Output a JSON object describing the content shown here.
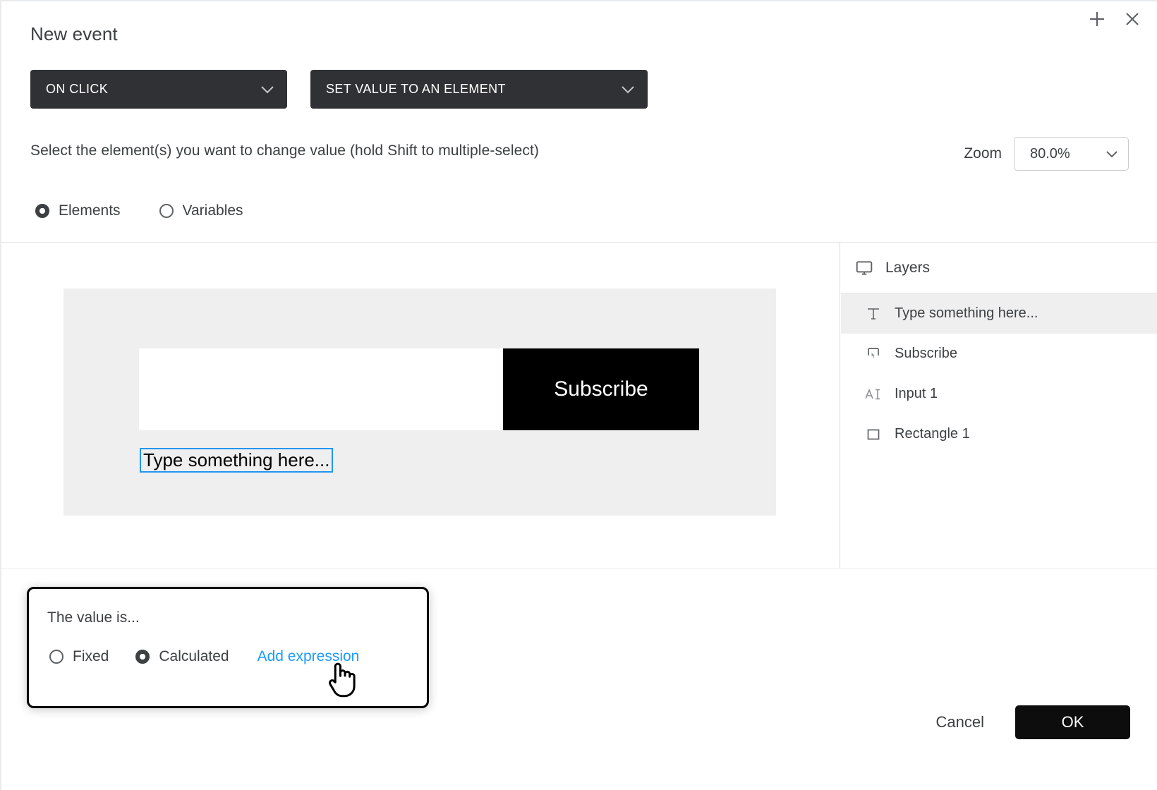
{
  "dialog": {
    "title": "New event",
    "add_icon": "plus-icon",
    "close_icon": "close-icon"
  },
  "event": {
    "trigger_label": "ON CLICK",
    "action_label": "SET VALUE TO AN ELEMENT"
  },
  "instruction": {
    "text": "Select the element(s) you want to change value (hold Shift to multiple-select)"
  },
  "zoom": {
    "label": "Zoom",
    "value": "80.0%"
  },
  "target_mode": {
    "options": [
      {
        "label": "Elements",
        "selected": true
      },
      {
        "label": "Variables",
        "selected": false
      }
    ]
  },
  "canvas": {
    "input_placeholder": "",
    "subscribe_button_label": "Subscribe",
    "selected_text": "Type something here..."
  },
  "layers": {
    "header_label": "Layers",
    "header_icon": "monitor-icon",
    "items": [
      {
        "label": "Type something here...",
        "icon": "text-tool-icon",
        "selected": true
      },
      {
        "label": "Subscribe",
        "icon": "button-pointer-icon",
        "selected": false
      },
      {
        "label": "Input 1",
        "icon": "text-input-icon",
        "selected": false
      },
      {
        "label": "Rectangle 1",
        "icon": "rectangle-icon",
        "selected": false
      }
    ]
  },
  "value_popup": {
    "title": "The value is...",
    "options": [
      {
        "label": "Fixed",
        "selected": false
      },
      {
        "label": "Calculated",
        "selected": true
      }
    ],
    "add_expression_label": "Add expression",
    "link_color": "#1a9bfc"
  },
  "footer": {
    "cancel_label": "Cancel",
    "ok_label": "OK"
  },
  "cursor": {
    "type": "pointing-hand"
  }
}
